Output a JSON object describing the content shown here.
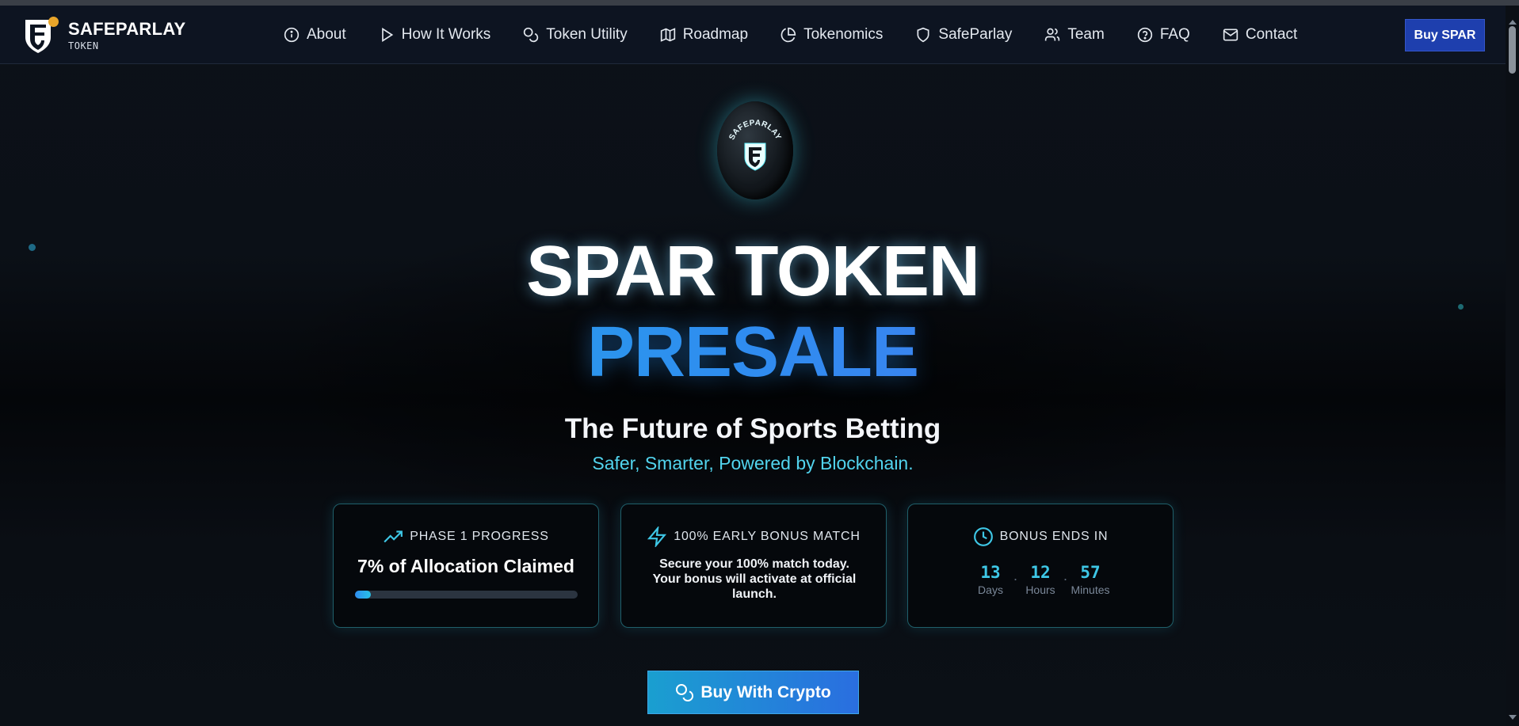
{
  "nav": {
    "logo": {
      "name": "SAFEPARLAY",
      "sub": "TOKEN"
    },
    "items": [
      {
        "label": "About",
        "icon": "info-icon"
      },
      {
        "label": "How It Works",
        "icon": "play-icon"
      },
      {
        "label": "Token Utility",
        "icon": "coins-icon"
      },
      {
        "label": "Roadmap",
        "icon": "map-icon"
      },
      {
        "label": "Tokenomics",
        "icon": "pie-chart-icon"
      },
      {
        "label": "SafeParlay",
        "icon": "shield-icon"
      },
      {
        "label": "Team",
        "icon": "users-icon"
      },
      {
        "label": "FAQ",
        "icon": "help-circle-icon"
      },
      {
        "label": "Contact",
        "icon": "mail-icon"
      }
    ],
    "buy_label": "Buy SPAR"
  },
  "hero": {
    "coin_text": "SAFEPARLAY",
    "title": "SPAR TOKEN",
    "title_accent": "PRESALE",
    "subtitle": "The Future of Sports Betting",
    "tagline": "Safer, Smarter, Powered by Blockchain."
  },
  "cards": {
    "progress": {
      "heading": "PHASE 1 PROGRESS",
      "value": "7% of Allocation Claimed",
      "percent": 7,
      "icon": "trending-up-icon"
    },
    "bonus": {
      "heading": "100% EARLY BONUS MATCH",
      "text": "Secure your 100% match today. Your bonus will activate at official launch.",
      "icon": "zap-icon"
    },
    "countdown": {
      "heading": "BONUS ENDS IN",
      "icon": "clock-icon",
      "days": "13",
      "days_label": "Days",
      "hours": "12",
      "hours_label": "Hours",
      "minutes": "57",
      "minutes_label": "Minutes",
      "separator": "."
    }
  },
  "cta": {
    "label": "Buy With Crypto",
    "icon": "coins-icon"
  },
  "colors": {
    "accent": "#3ec7e6",
    "brand_blue": "#1e3fae",
    "presale_gradient": [
      "#1fb3e0",
      "#5a6ff0"
    ],
    "logo_dot": "#e8a52a"
  }
}
